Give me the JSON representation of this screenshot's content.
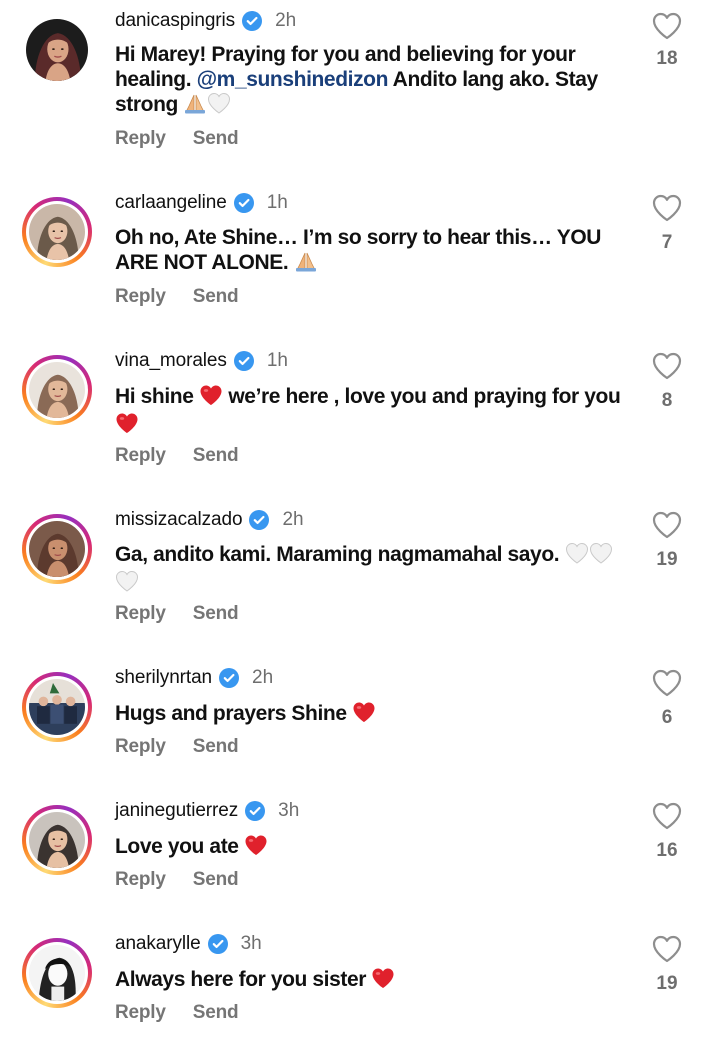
{
  "comments": [
    {
      "username": "danicaspingris",
      "verified": true,
      "time": "2h",
      "text_parts": [
        {
          "t": "Hi Marey! Praying for you and believing for your healing. "
        },
        {
          "t": "@m_sunshinedizon",
          "mention": true
        },
        {
          "t": " Andito lang ako. Stay strong "
        },
        {
          "emoji": "folded-hands-icon"
        },
        {
          "emoji": "white-heart-icon"
        }
      ],
      "reply_label": "Reply",
      "send_label": "Send",
      "likes": "18",
      "avatar_ring": false,
      "avatar_tone": "#5a2a2a"
    },
    {
      "username": "carlaangeline",
      "verified": true,
      "time": "1h",
      "text_parts": [
        {
          "t": "Oh no, Ate Shine… I’m so sorry to hear this… YOU ARE NOT ALONE. "
        },
        {
          "emoji": "folded-hands-icon"
        }
      ],
      "reply_label": "Reply",
      "send_label": "Send",
      "likes": "7",
      "avatar_ring": true,
      "avatar_tone": "#6b5a4a"
    },
    {
      "username": "vina_morales",
      "verified": true,
      "time": "1h",
      "text_parts": [
        {
          "t": "Hi shine "
        },
        {
          "emoji": "red-heart-icon"
        },
        {
          "t": " we’re here , love you and praying for you "
        },
        {
          "emoji": "red-heart-icon"
        }
      ],
      "reply_label": "Reply",
      "send_label": "Send",
      "likes": "8",
      "avatar_ring": true,
      "avatar_tone": "#8a6a56"
    },
    {
      "username": "missizacalzado",
      "verified": true,
      "time": "2h",
      "text_parts": [
        {
          "t": "Ga, andito kami. Maraming nagmamahal sayo. "
        },
        {
          "emoji": "white-heart-icon"
        },
        {
          "emoji": "white-heart-icon"
        },
        {
          "emoji": "white-heart-icon"
        }
      ],
      "reply_label": "Reply",
      "send_label": "Send",
      "likes": "19",
      "avatar_ring": true,
      "avatar_tone": "#5c3a2e"
    },
    {
      "username": "sherilynrtan",
      "verified": true,
      "time": "2h",
      "text_parts": [
        {
          "t": "Hugs and prayers Shine "
        },
        {
          "emoji": "red-heart-icon"
        }
      ],
      "reply_label": "Reply",
      "send_label": "Send",
      "likes": "6",
      "avatar_ring": true,
      "avatar_tone": "#2e3f5c"
    },
    {
      "username": "janinegutierrez",
      "verified": true,
      "time": "3h",
      "text_parts": [
        {
          "t": "Love you ate "
        },
        {
          "emoji": "red-heart-icon"
        }
      ],
      "reply_label": "Reply",
      "send_label": "Send",
      "likes": "16",
      "avatar_ring": true,
      "avatar_tone": "#3a3330"
    },
    {
      "username": "anakarylle",
      "verified": true,
      "time": "3h",
      "text_parts": [
        {
          "t": "Always here for you sister "
        },
        {
          "emoji": "red-heart-icon"
        }
      ],
      "reply_label": "Reply",
      "send_label": "Send",
      "likes": "19",
      "avatar_ring": true,
      "avatar_tone": "#4a4a4a"
    }
  ],
  "colors": {
    "verified_badge": "#3897f0",
    "mention": "#1a3f7a",
    "secondary_text": "#757575",
    "emoji_red_heart": "#e0212c",
    "emoji_white_heart": "#f2f2f2"
  }
}
